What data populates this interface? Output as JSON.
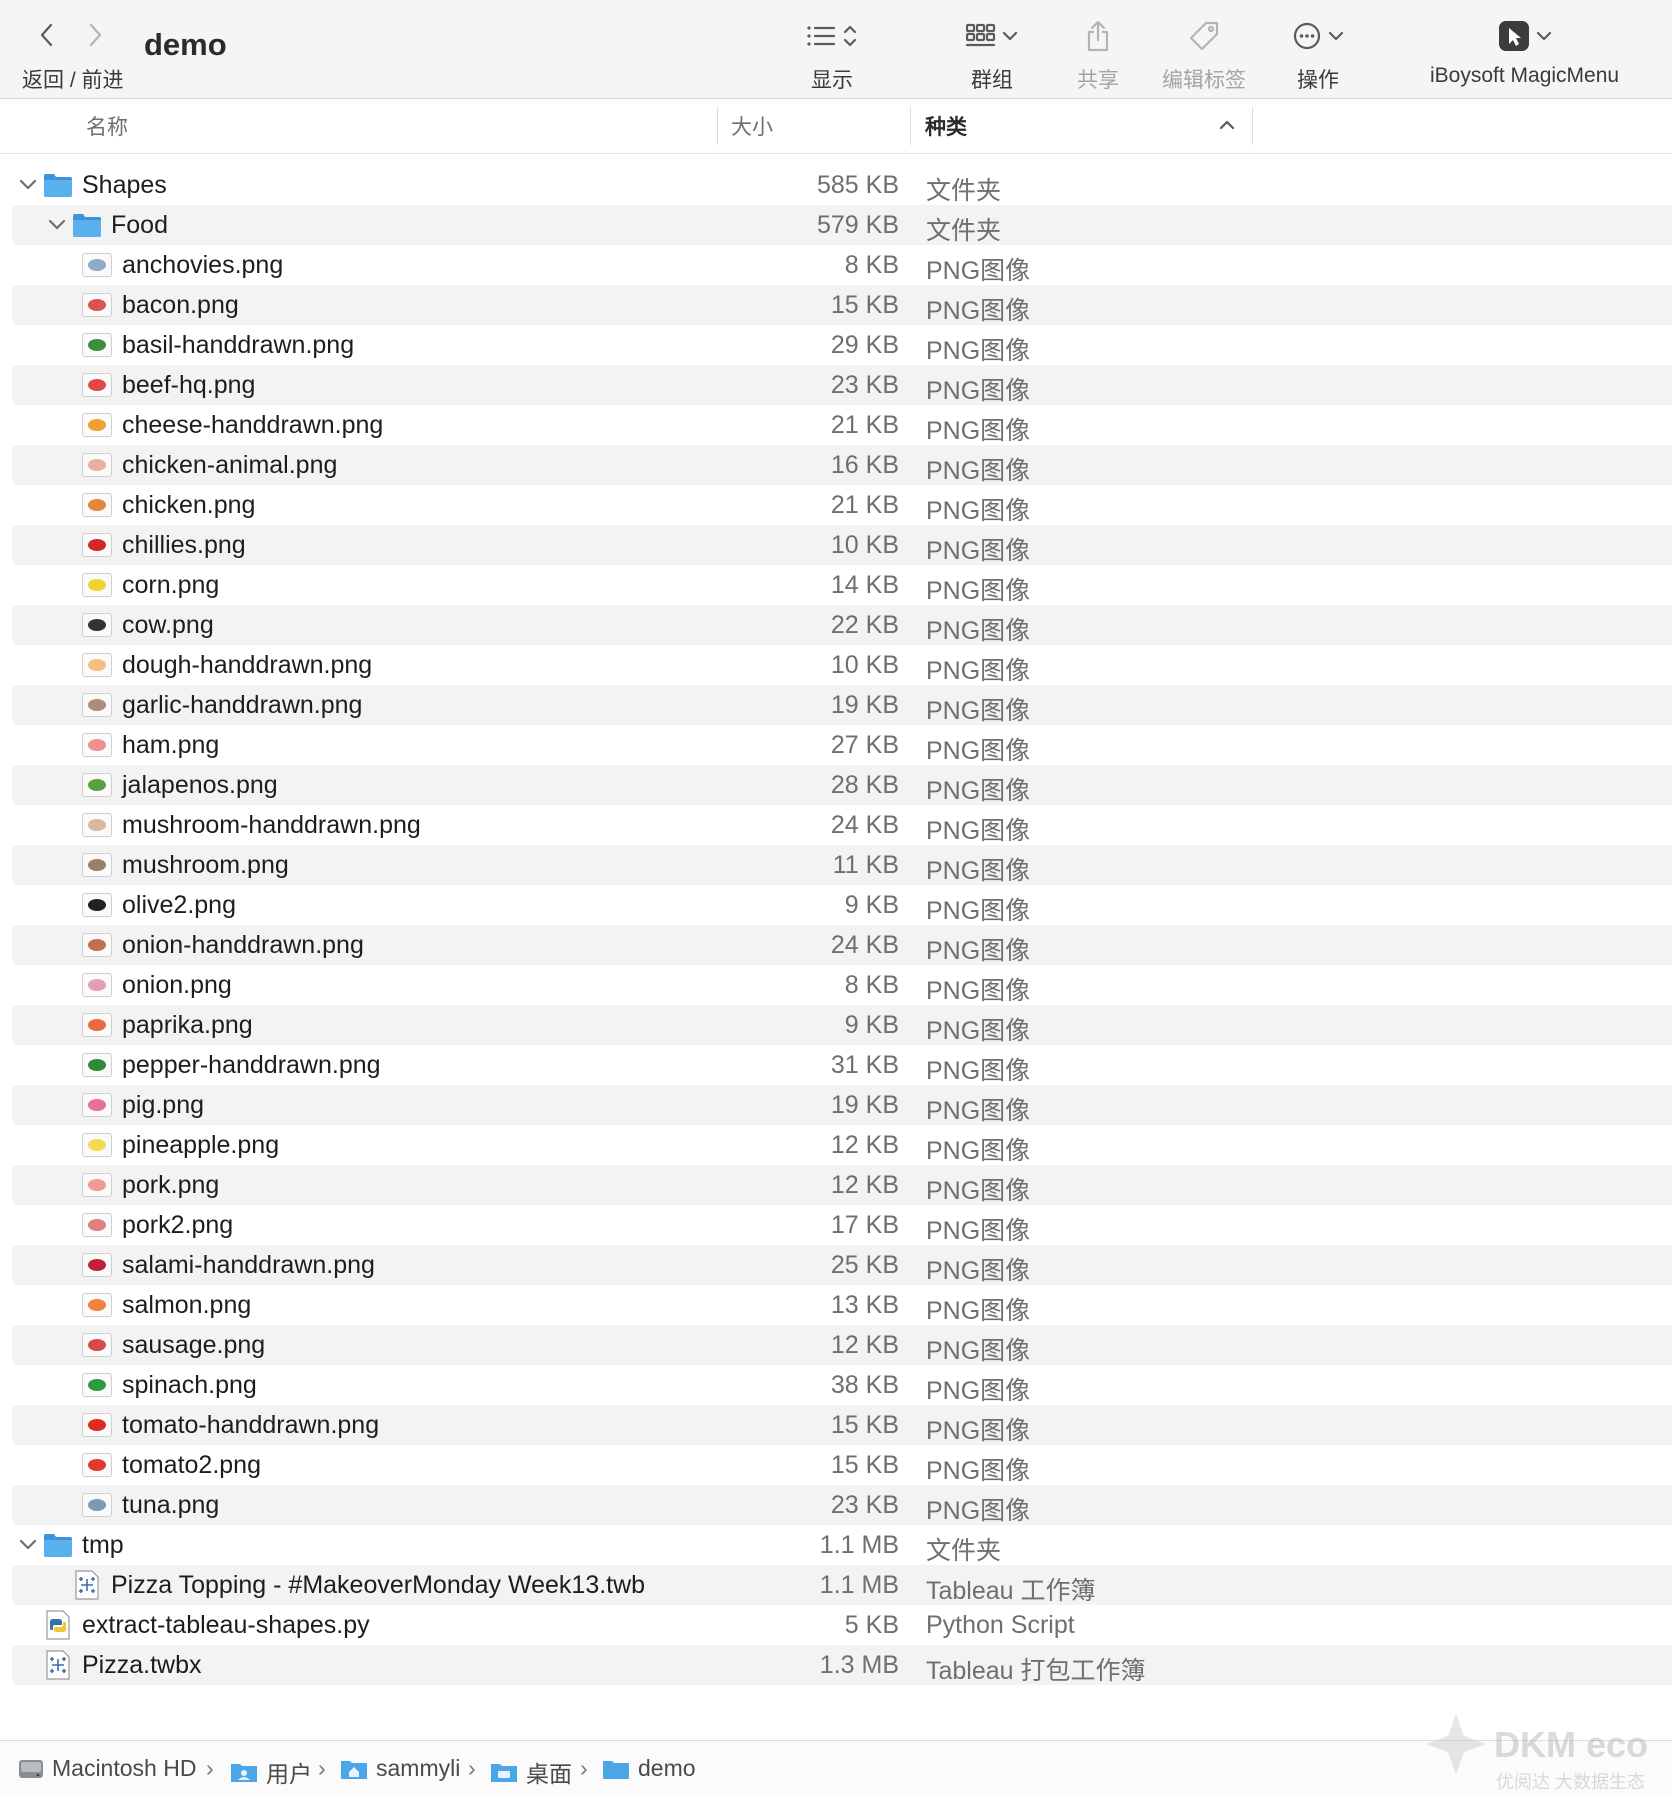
{
  "toolbar": {
    "back_forward_label": "返回 / 前进",
    "title": "demo",
    "view_label": "显示",
    "group_label": "群组",
    "share_label": "共享",
    "edit_tags_label": "编辑标签",
    "action_label": "操作",
    "magicmenu_label": "iBoysoft MagicMenu"
  },
  "columns": {
    "name": "名称",
    "size": "大小",
    "kind": "种类"
  },
  "rows": [
    {
      "name": "Shapes",
      "size": "585 KB",
      "kind": "文件夹",
      "type": "folder",
      "level": 0,
      "expanded": true
    },
    {
      "name": "Food",
      "size": "579 KB",
      "kind": "文件夹",
      "type": "folder",
      "level": 1,
      "expanded": true
    },
    {
      "name": "anchovies.png",
      "size": "8 KB",
      "kind": "PNG图像",
      "type": "png",
      "level": 2,
      "color": "#8fa9c9"
    },
    {
      "name": "bacon.png",
      "size": "15 KB",
      "kind": "PNG图像",
      "type": "png",
      "level": 2,
      "color": "#d9534f"
    },
    {
      "name": "basil-handdrawn.png",
      "size": "29 KB",
      "kind": "PNG图像",
      "type": "png",
      "level": 2,
      "color": "#3a8f3a"
    },
    {
      "name": "beef-hq.png",
      "size": "23 KB",
      "kind": "PNG图像",
      "type": "png",
      "level": 2,
      "color": "#e04848"
    },
    {
      "name": "cheese-handdrawn.png",
      "size": "21 KB",
      "kind": "PNG图像",
      "type": "png",
      "level": 2,
      "color": "#f0a030"
    },
    {
      "name": "chicken-animal.png",
      "size": "16 KB",
      "kind": "PNG图像",
      "type": "png",
      "level": 2,
      "color": "#e8b0a0"
    },
    {
      "name": "chicken.png",
      "size": "21 KB",
      "kind": "PNG图像",
      "type": "png",
      "level": 2,
      "color": "#e0893a"
    },
    {
      "name": "chillies.png",
      "size": "10 KB",
      "kind": "PNG图像",
      "type": "png",
      "level": 2,
      "color": "#d02828"
    },
    {
      "name": "corn.png",
      "size": "14 KB",
      "kind": "PNG图像",
      "type": "png",
      "level": 2,
      "color": "#f2d230"
    },
    {
      "name": "cow.png",
      "size": "22 KB",
      "kind": "PNG图像",
      "type": "png",
      "level": 2,
      "color": "#333333"
    },
    {
      "name": "dough-handdrawn.png",
      "size": "10 KB",
      "kind": "PNG图像",
      "type": "png",
      "level": 2,
      "color": "#f2bf80"
    },
    {
      "name": "garlic-handdrawn.png",
      "size": "19 KB",
      "kind": "PNG图像",
      "type": "png",
      "level": 2,
      "color": "#b08a7a"
    },
    {
      "name": "ham.png",
      "size": "27 KB",
      "kind": "PNG图像",
      "type": "png",
      "level": 2,
      "color": "#f08f8f"
    },
    {
      "name": "jalapenos.png",
      "size": "28 KB",
      "kind": "PNG图像",
      "type": "png",
      "level": 2,
      "color": "#5aa040"
    },
    {
      "name": "mushroom-handdrawn.png",
      "size": "24 KB",
      "kind": "PNG图像",
      "type": "png",
      "level": 2,
      "color": "#d8b8a0"
    },
    {
      "name": "mushroom.png",
      "size": "11 KB",
      "kind": "PNG图像",
      "type": "png",
      "level": 2,
      "color": "#9a8068"
    },
    {
      "name": "olive2.png",
      "size": "9 KB",
      "kind": "PNG图像",
      "type": "png",
      "level": 2,
      "color": "#222222"
    },
    {
      "name": "onion-handdrawn.png",
      "size": "24 KB",
      "kind": "PNG图像",
      "type": "png",
      "level": 2,
      "color": "#c07050"
    },
    {
      "name": "onion.png",
      "size": "8 KB",
      "kind": "PNG图像",
      "type": "png",
      "level": 2,
      "color": "#e0a0b0"
    },
    {
      "name": "paprika.png",
      "size": "9 KB",
      "kind": "PNG图像",
      "type": "png",
      "level": 2,
      "color": "#e86a40"
    },
    {
      "name": "pepper-handdrawn.png",
      "size": "31 KB",
      "kind": "PNG图像",
      "type": "png",
      "level": 2,
      "color": "#2f8a3a"
    },
    {
      "name": "pig.png",
      "size": "19 KB",
      "kind": "PNG图像",
      "type": "png",
      "level": 2,
      "color": "#e87090"
    },
    {
      "name": "pineapple.png",
      "size": "12 KB",
      "kind": "PNG图像",
      "type": "png",
      "level": 2,
      "color": "#f4dc50"
    },
    {
      "name": "pork.png",
      "size": "12 KB",
      "kind": "PNG图像",
      "type": "png",
      "level": 2,
      "color": "#f09a90"
    },
    {
      "name": "pork2.png",
      "size": "17 KB",
      "kind": "PNG图像",
      "type": "png",
      "level": 2,
      "color": "#e08080"
    },
    {
      "name": "salami-handdrawn.png",
      "size": "25 KB",
      "kind": "PNG图像",
      "type": "png",
      "level": 2,
      "color": "#c0203a"
    },
    {
      "name": "salmon.png",
      "size": "13 KB",
      "kind": "PNG图像",
      "type": "png",
      "level": 2,
      "color": "#f28040"
    },
    {
      "name": "sausage.png",
      "size": "12 KB",
      "kind": "PNG图像",
      "type": "png",
      "level": 2,
      "color": "#d84a4a"
    },
    {
      "name": "spinach.png",
      "size": "38 KB",
      "kind": "PNG图像",
      "type": "png",
      "level": 2,
      "color": "#2e9a40"
    },
    {
      "name": "tomato-handdrawn.png",
      "size": "15 KB",
      "kind": "PNG图像",
      "type": "png",
      "level": 2,
      "color": "#e02a20"
    },
    {
      "name": "tomato2.png",
      "size": "15 KB",
      "kind": "PNG图像",
      "type": "png",
      "level": 2,
      "color": "#e03a30"
    },
    {
      "name": "tuna.png",
      "size": "23 KB",
      "kind": "PNG图像",
      "type": "png",
      "level": 2,
      "color": "#7a9ab8"
    },
    {
      "name": "tmp",
      "size": "1.1 MB",
      "kind": "文件夹",
      "type": "folder",
      "level": 0,
      "expanded": true
    },
    {
      "name": "Pizza Topping - #MakeoverMonday Week13.twb",
      "size": "1.1 MB",
      "kind": "Tableau 工作簿",
      "type": "tableau",
      "level": 1
    },
    {
      "name": "extract-tableau-shapes.py",
      "size": "5 KB",
      "kind": "Python Script",
      "type": "python",
      "level": 0
    },
    {
      "name": "Pizza.twbx",
      "size": "1.3 MB",
      "kind": "Tableau 打包工作簿",
      "type": "tableau",
      "level": 0
    }
  ],
  "pathbar": {
    "items": [
      {
        "label": "Macintosh HD",
        "icon": "hard-drive-icon"
      },
      {
        "label": "用户",
        "icon": "users-folder-icon"
      },
      {
        "label": "sammyli",
        "icon": "home-folder-icon"
      },
      {
        "label": "桌面",
        "icon": "desktop-folder-icon"
      },
      {
        "label": "demo",
        "icon": "folder-icon"
      }
    ]
  },
  "watermark": {
    "line1": "DKM eco",
    "line2": "优阅达 大数据生态"
  },
  "colors": {
    "folder": "#5ab0ec",
    "folder_tab": "#3b94d6",
    "row_alt": "#f3f3f4"
  }
}
